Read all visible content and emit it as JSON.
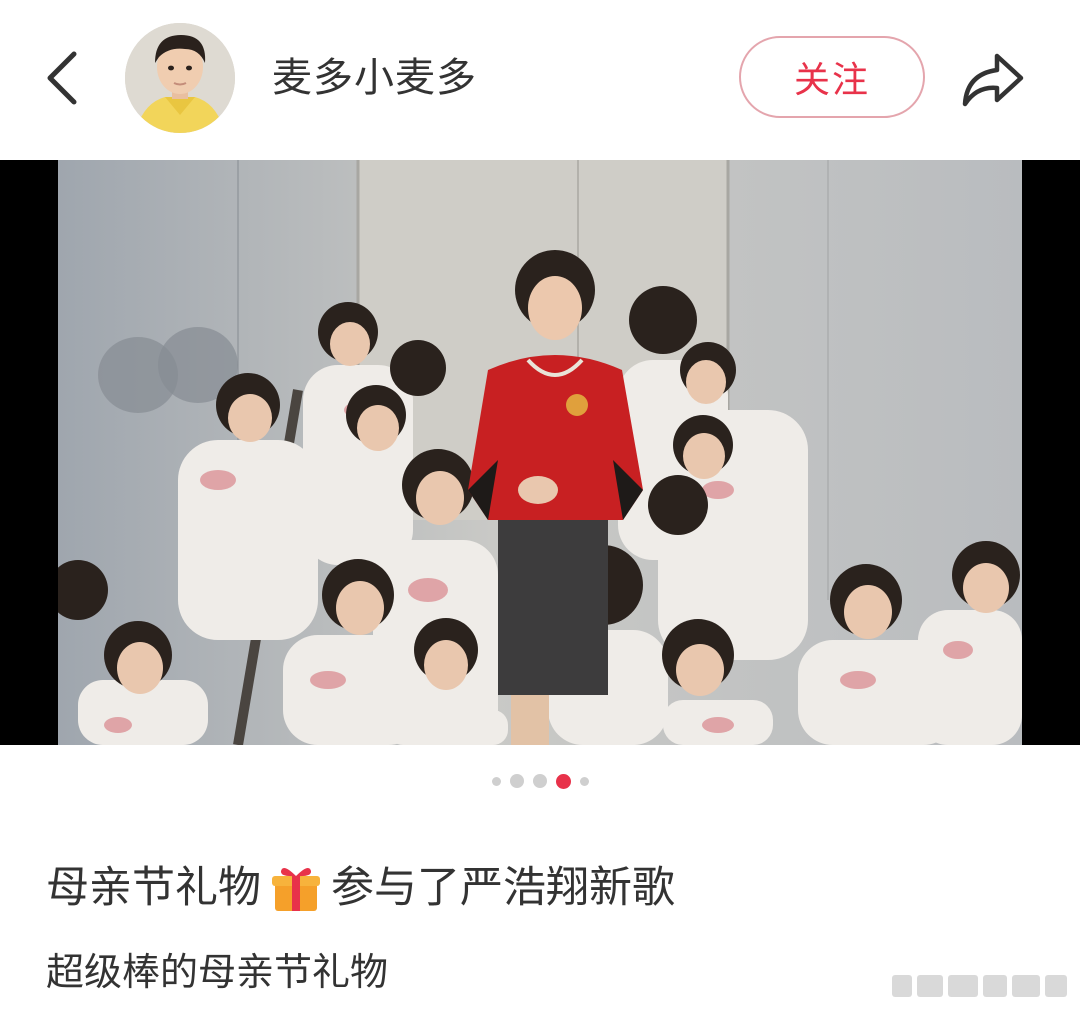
{
  "header": {
    "back_icon": "chevron-left-icon",
    "author_name": "麦多小麦多",
    "follow_label": "关注",
    "share_icon": "share-arrow-icon",
    "colors": {
      "accent": "#e8324a",
      "follow_border": "#e4a5ad",
      "text": "#333333"
    }
  },
  "carousel": {
    "slide_count": 5,
    "active_index": 3,
    "colors": {
      "active_dot": "#e8324a",
      "inactive_dot": "#cfcfcf"
    }
  },
  "post": {
    "title_before_emoji": "母亲节礼物",
    "title_emoji": "gift-icon",
    "title_after_emoji": "参与了严浩翔新歌",
    "body": "超级棒的母亲节礼物"
  }
}
